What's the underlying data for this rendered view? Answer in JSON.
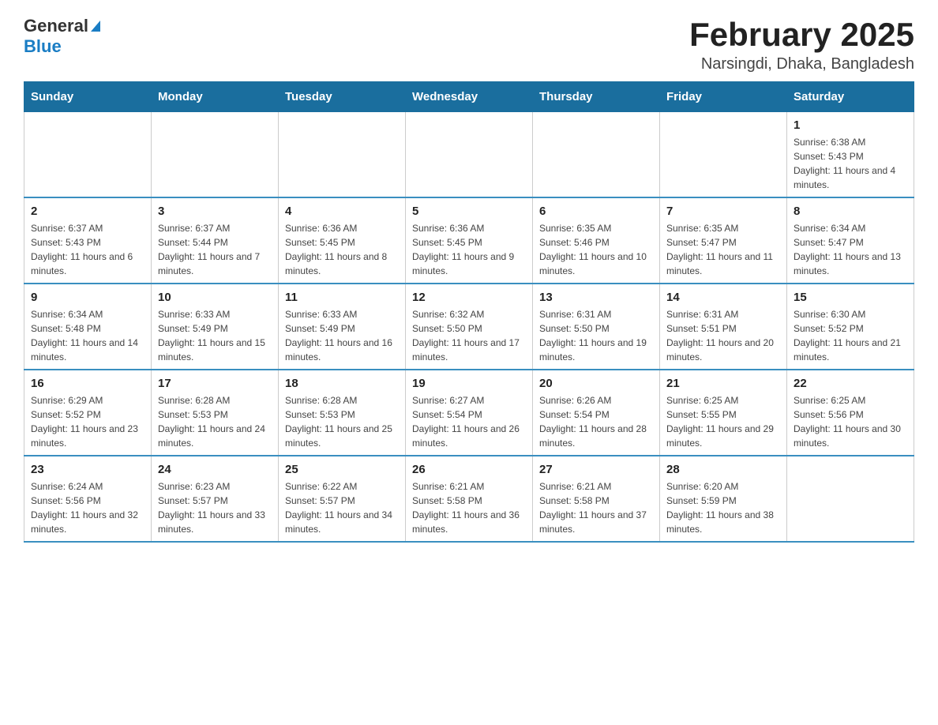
{
  "header": {
    "logo_general": "General",
    "logo_blue": "Blue",
    "month_title": "February 2025",
    "location": "Narsingdi, Dhaka, Bangladesh"
  },
  "days_of_week": [
    "Sunday",
    "Monday",
    "Tuesday",
    "Wednesday",
    "Thursday",
    "Friday",
    "Saturday"
  ],
  "weeks": [
    {
      "days": [
        {
          "number": "",
          "info": ""
        },
        {
          "number": "",
          "info": ""
        },
        {
          "number": "",
          "info": ""
        },
        {
          "number": "",
          "info": ""
        },
        {
          "number": "",
          "info": ""
        },
        {
          "number": "",
          "info": ""
        },
        {
          "number": "1",
          "info": "Sunrise: 6:38 AM\nSunset: 5:43 PM\nDaylight: 11 hours and 4 minutes."
        }
      ]
    },
    {
      "days": [
        {
          "number": "2",
          "info": "Sunrise: 6:37 AM\nSunset: 5:43 PM\nDaylight: 11 hours and 6 minutes."
        },
        {
          "number": "3",
          "info": "Sunrise: 6:37 AM\nSunset: 5:44 PM\nDaylight: 11 hours and 7 minutes."
        },
        {
          "number": "4",
          "info": "Sunrise: 6:36 AM\nSunset: 5:45 PM\nDaylight: 11 hours and 8 minutes."
        },
        {
          "number": "5",
          "info": "Sunrise: 6:36 AM\nSunset: 5:45 PM\nDaylight: 11 hours and 9 minutes."
        },
        {
          "number": "6",
          "info": "Sunrise: 6:35 AM\nSunset: 5:46 PM\nDaylight: 11 hours and 10 minutes."
        },
        {
          "number": "7",
          "info": "Sunrise: 6:35 AM\nSunset: 5:47 PM\nDaylight: 11 hours and 11 minutes."
        },
        {
          "number": "8",
          "info": "Sunrise: 6:34 AM\nSunset: 5:47 PM\nDaylight: 11 hours and 13 minutes."
        }
      ]
    },
    {
      "days": [
        {
          "number": "9",
          "info": "Sunrise: 6:34 AM\nSunset: 5:48 PM\nDaylight: 11 hours and 14 minutes."
        },
        {
          "number": "10",
          "info": "Sunrise: 6:33 AM\nSunset: 5:49 PM\nDaylight: 11 hours and 15 minutes."
        },
        {
          "number": "11",
          "info": "Sunrise: 6:33 AM\nSunset: 5:49 PM\nDaylight: 11 hours and 16 minutes."
        },
        {
          "number": "12",
          "info": "Sunrise: 6:32 AM\nSunset: 5:50 PM\nDaylight: 11 hours and 17 minutes."
        },
        {
          "number": "13",
          "info": "Sunrise: 6:31 AM\nSunset: 5:50 PM\nDaylight: 11 hours and 19 minutes."
        },
        {
          "number": "14",
          "info": "Sunrise: 6:31 AM\nSunset: 5:51 PM\nDaylight: 11 hours and 20 minutes."
        },
        {
          "number": "15",
          "info": "Sunrise: 6:30 AM\nSunset: 5:52 PM\nDaylight: 11 hours and 21 minutes."
        }
      ]
    },
    {
      "days": [
        {
          "number": "16",
          "info": "Sunrise: 6:29 AM\nSunset: 5:52 PM\nDaylight: 11 hours and 23 minutes."
        },
        {
          "number": "17",
          "info": "Sunrise: 6:28 AM\nSunset: 5:53 PM\nDaylight: 11 hours and 24 minutes."
        },
        {
          "number": "18",
          "info": "Sunrise: 6:28 AM\nSunset: 5:53 PM\nDaylight: 11 hours and 25 minutes."
        },
        {
          "number": "19",
          "info": "Sunrise: 6:27 AM\nSunset: 5:54 PM\nDaylight: 11 hours and 26 minutes."
        },
        {
          "number": "20",
          "info": "Sunrise: 6:26 AM\nSunset: 5:54 PM\nDaylight: 11 hours and 28 minutes."
        },
        {
          "number": "21",
          "info": "Sunrise: 6:25 AM\nSunset: 5:55 PM\nDaylight: 11 hours and 29 minutes."
        },
        {
          "number": "22",
          "info": "Sunrise: 6:25 AM\nSunset: 5:56 PM\nDaylight: 11 hours and 30 minutes."
        }
      ]
    },
    {
      "days": [
        {
          "number": "23",
          "info": "Sunrise: 6:24 AM\nSunset: 5:56 PM\nDaylight: 11 hours and 32 minutes."
        },
        {
          "number": "24",
          "info": "Sunrise: 6:23 AM\nSunset: 5:57 PM\nDaylight: 11 hours and 33 minutes."
        },
        {
          "number": "25",
          "info": "Sunrise: 6:22 AM\nSunset: 5:57 PM\nDaylight: 11 hours and 34 minutes."
        },
        {
          "number": "26",
          "info": "Sunrise: 6:21 AM\nSunset: 5:58 PM\nDaylight: 11 hours and 36 minutes."
        },
        {
          "number": "27",
          "info": "Sunrise: 6:21 AM\nSunset: 5:58 PM\nDaylight: 11 hours and 37 minutes."
        },
        {
          "number": "28",
          "info": "Sunrise: 6:20 AM\nSunset: 5:59 PM\nDaylight: 11 hours and 38 minutes."
        },
        {
          "number": "",
          "info": ""
        }
      ]
    }
  ]
}
